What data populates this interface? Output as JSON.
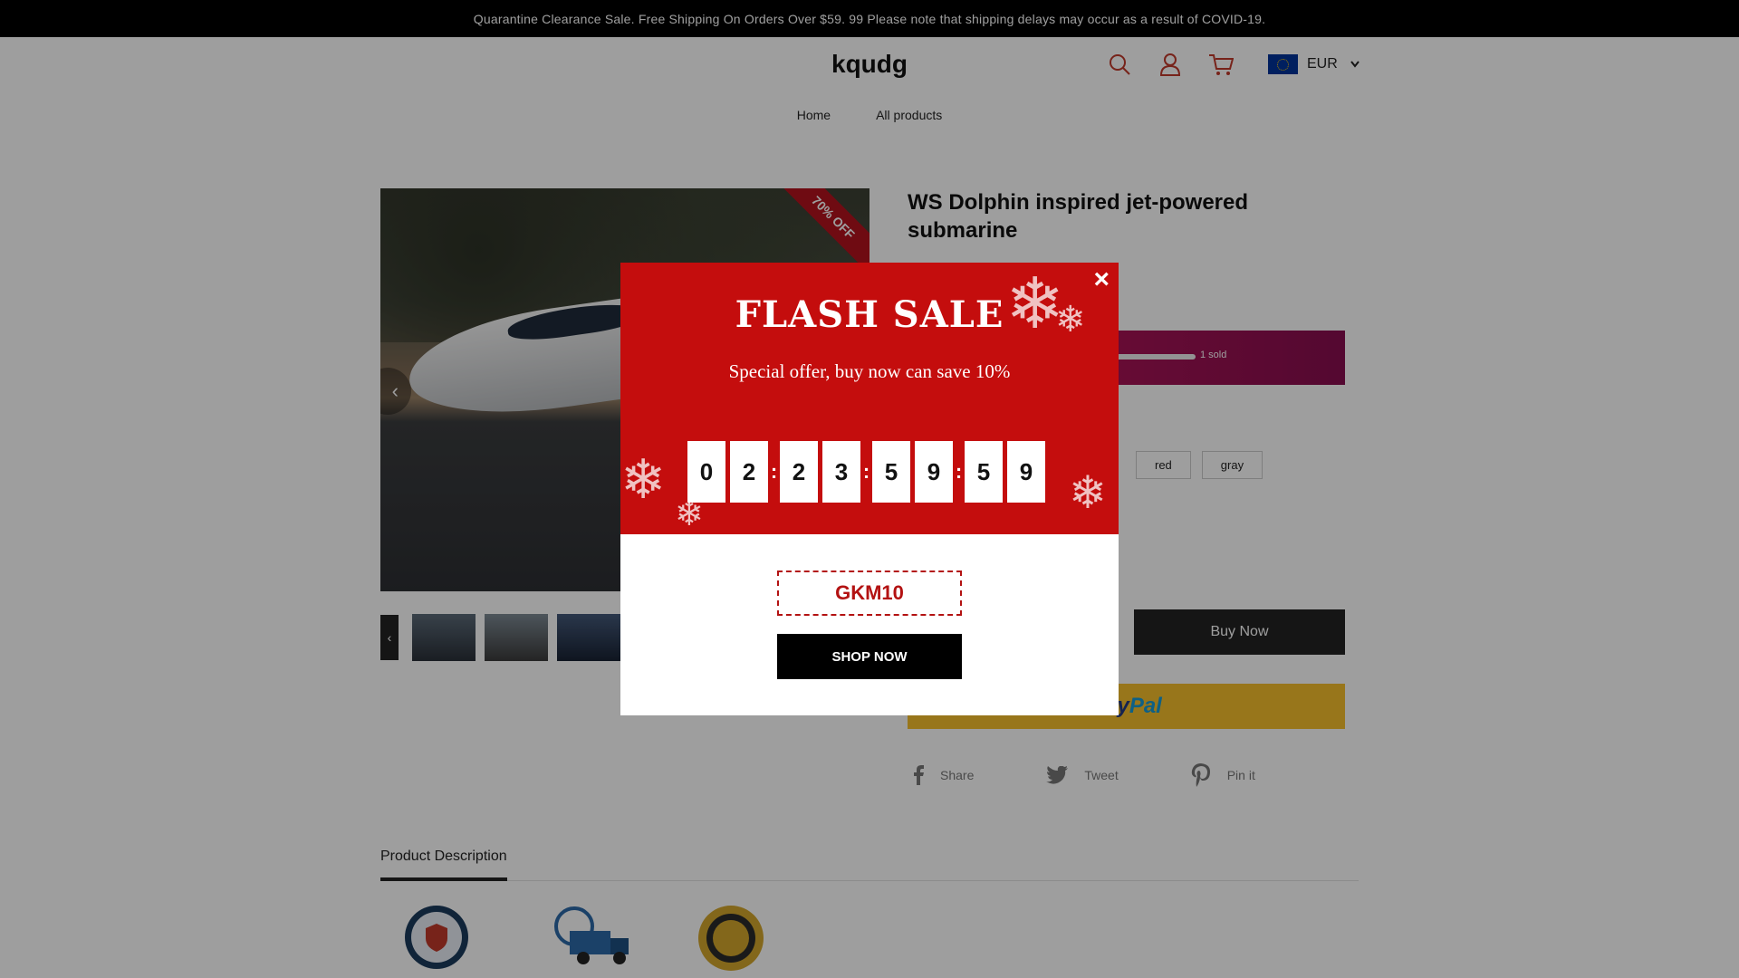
{
  "announcement": "Quarantine Clearance Sale. Free Shipping On Orders Over $59. 99 Please note that shipping delays may occur as a result of COVID-19.",
  "header": {
    "logo": "kqudg",
    "currency": "EUR",
    "icons": [
      "search-icon",
      "user-icon",
      "cart-icon"
    ]
  },
  "nav": {
    "items": [
      "Home",
      "All products"
    ]
  },
  "product": {
    "title": "WS Dolphin inspired jet-powered submarine",
    "discount_ribbon": "70% OFF",
    "sold": "1 sold",
    "options": [
      "red",
      "gray"
    ],
    "buy_now": "Buy Now",
    "paypal": {
      "brand_left": "Pay",
      "brand_right": "Pal",
      "visible_text": "yPal"
    }
  },
  "share": {
    "items": [
      {
        "label": "Share",
        "icon": "facebook-icon"
      },
      {
        "label": "Tweet",
        "icon": "twitter-icon"
      },
      {
        "label": "Pin it",
        "icon": "pinterest-icon"
      }
    ]
  },
  "tabs": {
    "active": "Product Description"
  },
  "popup": {
    "title": "FLASH SALE",
    "subtitle": "Special offer, buy now can save 10%",
    "countdown": [
      "0",
      "2",
      "2",
      "3",
      "5",
      "9",
      "5",
      "9"
    ],
    "coupon_code": "GKM10",
    "cta": "SHOP NOW",
    "close": "×"
  },
  "colors": {
    "popup_red": "#c40d0d",
    "sold_bar": "#c2185b",
    "paypal_yellow": "#f5bf2c",
    "announcement_bg": "#000000"
  }
}
